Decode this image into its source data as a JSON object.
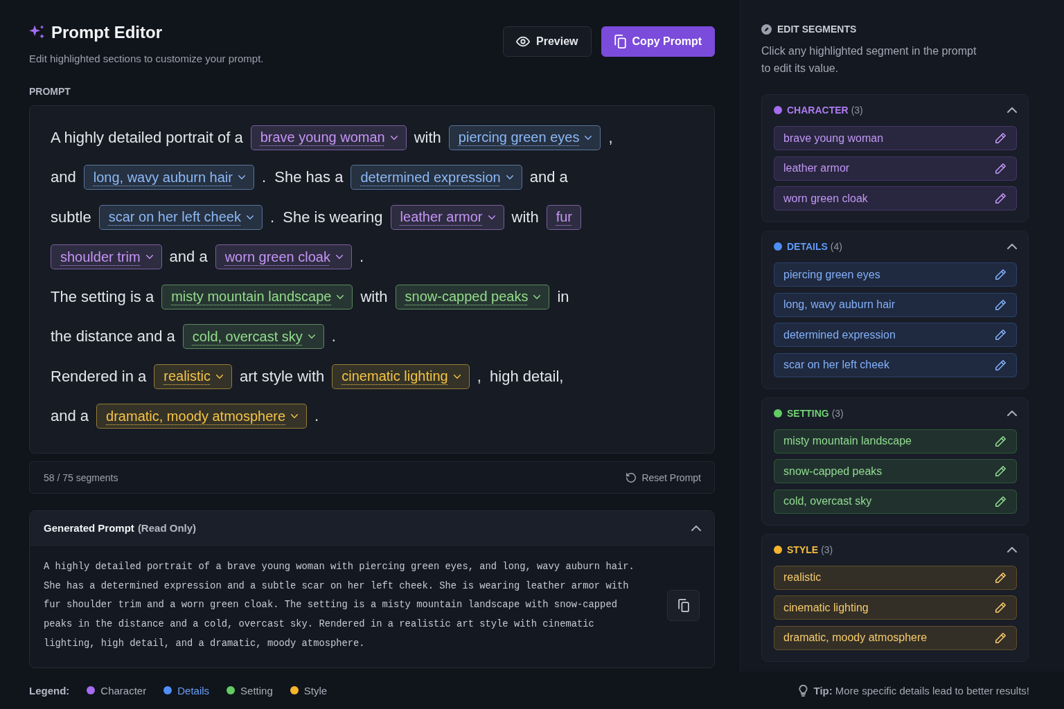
{
  "header": {
    "title": "Prompt Editor",
    "subtitle": "Edit highlighted sections to customize your prompt."
  },
  "actions": [
    {
      "label": "Preview",
      "kind": "secondary"
    },
    {
      "label": "Copy Prompt",
      "kind": "primary"
    }
  ],
  "prompt": {
    "label": "PROMPT",
    "lines": [
      {
        "pieces": [
          {
            "kind": "text",
            "text": "A highly detailed portrait of a"
          },
          {
            "kind": "segment",
            "color": "#c595f5",
            "text": "brave young woman",
            "dropdown": true
          },
          {
            "kind": "text",
            "text": "with"
          },
          {
            "kind": "segment",
            "color": "#8cb9f6",
            "text": "piercing green eyes",
            "dropdown": true
          },
          {
            "kind": "text",
            "text": ","
          }
        ]
      },
      {
        "pieces": [
          {
            "kind": "text",
            "text": "and"
          },
          {
            "kind": "segment",
            "color": "#8cb9f6",
            "text": "long, wavy auburn hair",
            "dropdown": true
          },
          {
            "kind": "text",
            "text": ".  She has a"
          },
          {
            "kind": "segment",
            "color": "#8cb9f6",
            "text": "determined expression",
            "dropdown": true
          },
          {
            "kind": "text",
            "text": "and a"
          }
        ]
      },
      {
        "pieces": [
          {
            "kind": "text",
            "text": "subtle"
          },
          {
            "kind": "segment",
            "color": "#8cb9f6",
            "text": "scar on her left cheek",
            "dropdown": true
          },
          {
            "kind": "text",
            "text": ".  She is wearing"
          },
          {
            "kind": "segment",
            "color": "#c595f5",
            "text": "leather armor",
            "dropdown": true
          },
          {
            "kind": "text",
            "text": "with"
          },
          {
            "kind": "segment",
            "color": "#c595f5",
            "text": "fur",
            "dropdown": false
          }
        ]
      },
      {
        "pieces": [
          {
            "kind": "segment",
            "color": "#c595f5",
            "text": "shoulder trim",
            "dropdown": true
          },
          {
            "kind": "text",
            "text": "and a"
          },
          {
            "kind": "segment",
            "color": "#c595f5",
            "text": "worn green cloak",
            "dropdown": true
          },
          {
            "kind": "text",
            "text": "."
          }
        ]
      },
      {
        "pieces": [
          {
            "kind": "text",
            "text": "The setting is a"
          },
          {
            "kind": "segment",
            "color": "#93dc8b",
            "text": "misty mountain landscape",
            "dropdown": true
          },
          {
            "kind": "text",
            "text": "with"
          },
          {
            "kind": "segment",
            "color": "#93dc8b",
            "text": "snow-capped peaks",
            "dropdown": true
          },
          {
            "kind": "text",
            "text": "in"
          }
        ]
      },
      {
        "pieces": [
          {
            "kind": "text",
            "text": "the distance and a"
          },
          {
            "kind": "segment",
            "color": "#93dc8b",
            "text": "cold, overcast sky",
            "dropdown": true
          },
          {
            "kind": "text",
            "text": "."
          }
        ]
      },
      {
        "pieces": [
          {
            "kind": "text",
            "text": "Rendered in a"
          },
          {
            "kind": "segment",
            "color": "#f6c445",
            "text": "realistic",
            "dropdown": true
          },
          {
            "kind": "text",
            "text": "art style with"
          },
          {
            "kind": "segment",
            "color": "#f6c445",
            "text": "cinematic lighting",
            "dropdown": true
          },
          {
            "kind": "text",
            "text": ",  high detail,"
          }
        ]
      },
      {
        "pieces": [
          {
            "kind": "text",
            "text": "and a"
          },
          {
            "kind": "segment",
            "color": "#f6c445",
            "text": "dramatic, moody atmosphere",
            "dropdown": true
          },
          {
            "kind": "text",
            "text": "."
          }
        ]
      }
    ]
  },
  "status_bar": {
    "count": "58 / 75 segments",
    "reset": "Reset Prompt"
  },
  "generated": {
    "title": "Generated Prompt",
    "note": "(Read Only)",
    "expanded": true,
    "text": "A highly detailed portrait of a brave young woman with piercing green eyes, and long, wavy auburn hair. She has a determined expression and a subtle scar on her left cheek. She is wearing leather armor with fur shoulder trim and a worn green cloak. The setting is a misty mountain landscape with snow-capped peaks in the distance and a cold, overcast sky. Rendered in a realistic art style with cinematic lighting, high detail, and a dramatic, moody atmosphere."
  },
  "sidebar": {
    "title": "EDIT SEGMENTS",
    "description": "Click any highlighted segment in the prompt to edit its value.",
    "groups": [
      {
        "name": "CHARACTER",
        "count": "(3)",
        "color": "#a56cef",
        "expanded": true,
        "items": [
          "brave young woman",
          "leather armor",
          "worn green cloak"
        ]
      },
      {
        "name": "DETAILS",
        "count": "(4)",
        "color": "#4f8ef6",
        "expanded": true,
        "items": [
          "piercing green eyes",
          "long, wavy auburn hair",
          "determined expression",
          "scar on her left cheek"
        ]
      },
      {
        "name": "SETTING",
        "count": "(3)",
        "color": "#62cc62",
        "expanded": true,
        "items": [
          "misty mountain landscape",
          "snow-capped peaks",
          "cold, overcast sky"
        ]
      },
      {
        "name": "STYLE",
        "count": "(3)",
        "color": "#f4b42c",
        "expanded": true,
        "items": [
          "realistic",
          "cinematic lighting",
          "dramatic, moody atmosphere"
        ]
      }
    ]
  },
  "legend": {
    "label": "Legend:",
    "items": [
      {
        "label": "Character",
        "color": "#a56cef",
        "highlighted": false
      },
      {
        "label": "Details",
        "color": "#4f8ef6",
        "highlighted": true
      },
      {
        "label": "Setting",
        "color": "#62cc62",
        "highlighted": false
      },
      {
        "label": "Style",
        "color": "#f4b42c",
        "highlighted": false
      }
    ]
  },
  "tip": {
    "text": "**Tip:** More specific details lead to better results!"
  }
}
